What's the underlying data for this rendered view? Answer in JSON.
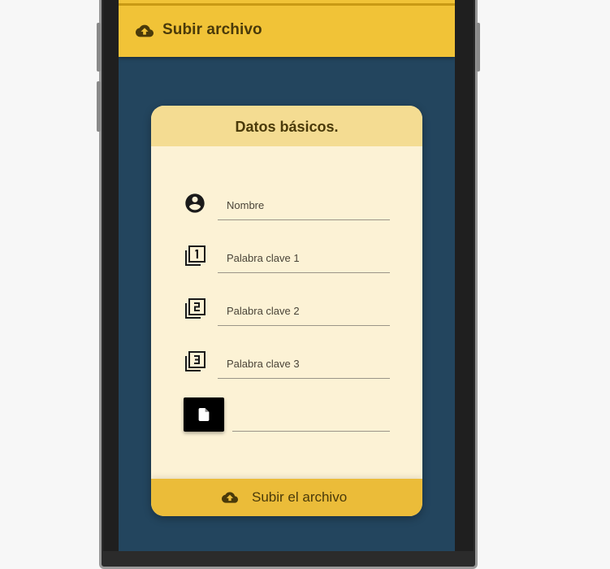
{
  "app_bar": {
    "icon": "cloud-upload-icon",
    "title": "Subir archivo"
  },
  "card": {
    "title": "Datos básicos.",
    "fields": [
      {
        "icon": "account-circle-icon",
        "placeholder": "Nombre",
        "value": ""
      },
      {
        "icon": "filter-1-icon",
        "placeholder": "Palabra clave 1",
        "value": ""
      },
      {
        "icon": "filter-2-icon",
        "placeholder": "Palabra clave 2",
        "value": ""
      },
      {
        "icon": "filter-3-icon",
        "placeholder": "Palabra clave 3",
        "value": ""
      }
    ],
    "file_button_icon": "file-icon",
    "file_name": "",
    "submit": {
      "icon": "cloud-upload-icon",
      "label": "Subir el archivo"
    }
  },
  "colors": {
    "app_bar": "#f1c337",
    "screen_background": "#23455e",
    "card_background": "#fcf2d5",
    "card_header": "#f4dc92",
    "card_footer": "#ebbc39",
    "text": "#4a3a0a"
  }
}
